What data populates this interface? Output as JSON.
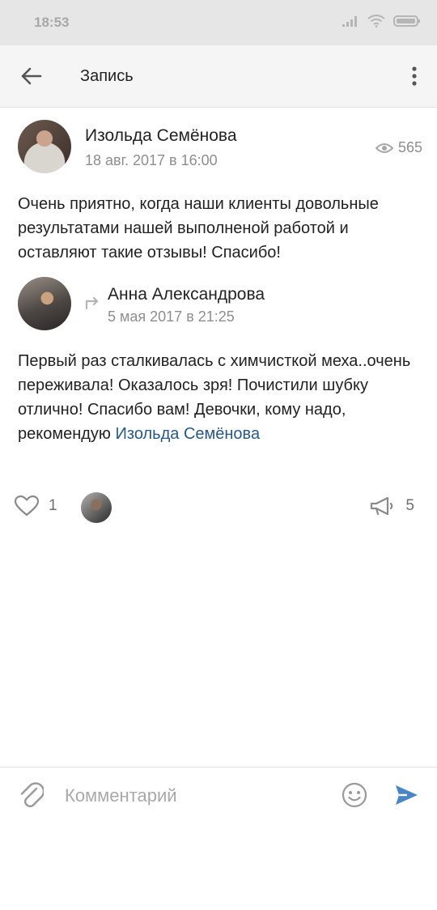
{
  "status_bar": {
    "time": "18:53"
  },
  "app_bar": {
    "title": "Запись"
  },
  "post": {
    "author": "Изольда Семёнова",
    "date": "18 авг. 2017 в 16:00",
    "views": "565",
    "text": "Очень приятно, когда наши клиенты довольные результатами нашей выполненой работой и оставляют такие отзывы! Спасибо!"
  },
  "repost": {
    "author": "Анна Александрова",
    "date": "5 мая 2017 в 21:25",
    "text": "Первый раз сталкивалась с химчисткой меха..очень переживала! Оказалось зря! Почистили шубку отлично! Спасибо вам! Девочки, кому надо, рекомендую ",
    "mention": "Изольда Семёнова"
  },
  "actions": {
    "likes": "1",
    "shares": "5"
  },
  "comment": {
    "placeholder": "Комментарий"
  },
  "colors": {
    "link": "#2a5885",
    "send": "#4a86c5"
  }
}
